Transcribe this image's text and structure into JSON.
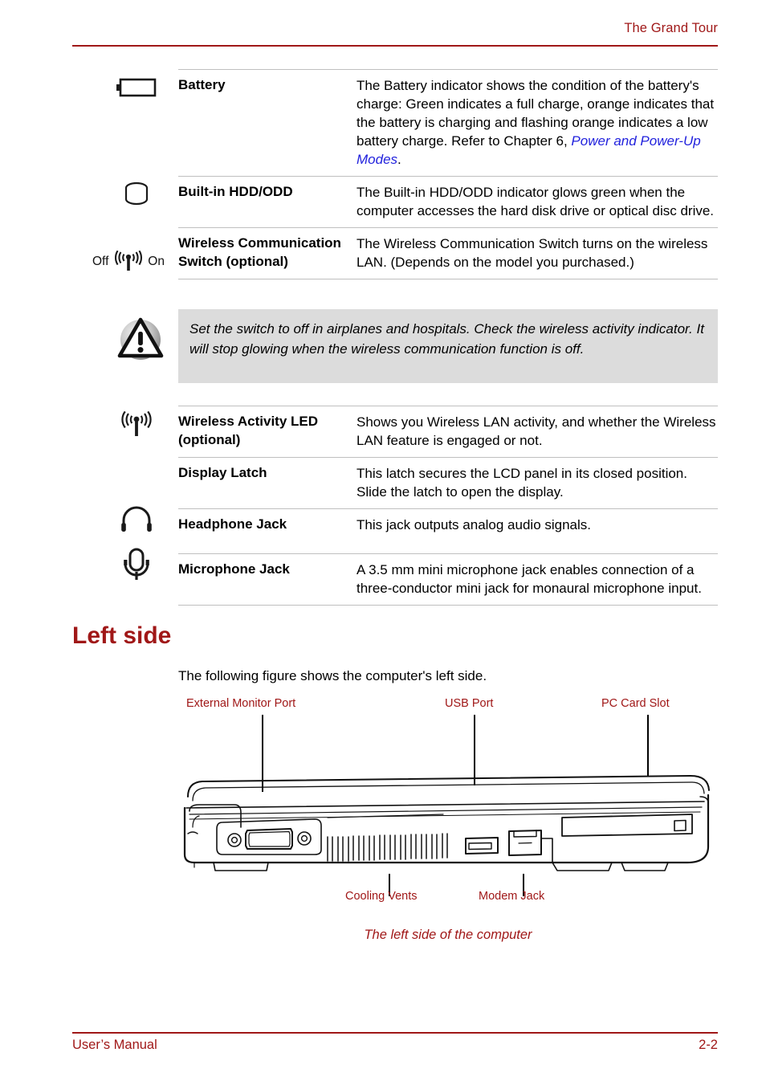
{
  "header": {
    "title": "The Grand Tour"
  },
  "footer": {
    "left": "User’s Manual",
    "right": "2-2"
  },
  "colors": {
    "accent_red": "#a01818",
    "link_blue": "#2222dd",
    "rule_gray": "#bfbfbf",
    "note_bg": "#dcdcdc"
  },
  "table": {
    "rows": [
      {
        "icon": "battery-icon",
        "name": "Battery",
        "desc_prefix": "The Battery indicator shows the condition of the battery's charge: Green indicates a full charge, orange indicates that the battery is charging and flashing orange indicates a low battery charge. Refer to Chapter 6, ",
        "desc_link": "Power and Power-Up Modes",
        "desc_suffix": "."
      },
      {
        "icon": "hard-disk-icon",
        "name": "Built-in HDD/ODD",
        "desc": "The Built-in HDD/ODD indicator glows green when the computer accesses the hard disk drive or optical disc drive."
      },
      {
        "icon": "wireless-switch-icon",
        "icon_left_label": "Off",
        "icon_right_label": "On",
        "name": "Wireless Communication Switch (optional)",
        "desc": "The Wireless Communication Switch turns on the wireless LAN. (Depends on the model you purchased.)"
      }
    ],
    "rows2": [
      {
        "icon": "wireless-antenna-icon",
        "name": "Wireless Activity LED (optional)",
        "desc": "Shows you Wireless LAN activity, and whether the Wireless LAN feature is engaged or not."
      },
      {
        "icon": "",
        "name": "Display Latch",
        "desc": "This latch secures the LCD panel in its closed position. Slide the latch to open the display."
      },
      {
        "icon": "headphone-icon",
        "name": "Headphone Jack",
        "desc": "This jack outputs analog audio signals."
      },
      {
        "icon": "microphone-icon",
        "name": "Microphone Jack",
        "desc": "A 3.5 mm mini microphone jack enables connection of a three-conductor mini jack for monaural microphone input."
      }
    ]
  },
  "note": {
    "icon": "warning-triangle-icon",
    "text": "Set the switch to off in airplanes and hospitals. Check the wireless activity indicator. It will stop glowing when the wireless communication function is off."
  },
  "section": {
    "heading": "Left side",
    "intro": "The following figure shows the computer's left side."
  },
  "figure": {
    "caption": "The left side of the computer",
    "labels_top": [
      {
        "text": "External Monitor Port",
        "name": "external-monitor-port-label"
      },
      {
        "text": "USB Port",
        "name": "usb-port-label"
      },
      {
        "text": "PC Card Slot",
        "name": "pc-card-slot-label"
      }
    ],
    "labels_bottom": [
      {
        "text": "Cooling Vents",
        "name": "cooling-vents-label"
      },
      {
        "text": "Modem Jack",
        "name": "modem-jack-label"
      }
    ]
  }
}
